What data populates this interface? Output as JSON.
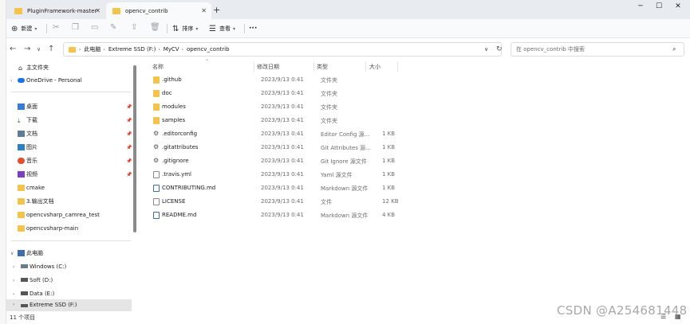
{
  "tabs": [
    {
      "label": "PluginFramework-master",
      "active": false
    },
    {
      "label": "opencv_contrib",
      "active": true
    }
  ],
  "window_controls": {
    "minimize": "─",
    "maximize": "☐",
    "close": "✕"
  },
  "command_bar": {
    "new_label": "新建",
    "sort_label": "排序",
    "view_label": "查看",
    "more_label": "···"
  },
  "breadcrumb": [
    "此电脑",
    "Extreme SSD (F:)",
    "MyCV",
    "opencv_contrib"
  ],
  "search": {
    "placeholder": "在 opencv_contrib 中搜索"
  },
  "nav": {
    "quick": [
      {
        "label": "主文件夹",
        "icon": "home-icon"
      },
      {
        "label": "OneDrive - Personal",
        "icon": "cloud-icon"
      }
    ],
    "pinned": [
      {
        "label": "桌面",
        "icon": "desktop-icon"
      },
      {
        "label": "下载",
        "icon": "download-icon"
      },
      {
        "label": "文档",
        "icon": "document-icon"
      },
      {
        "label": "图片",
        "icon": "picture-icon"
      },
      {
        "label": "音乐",
        "icon": "music-icon"
      },
      {
        "label": "视频",
        "icon": "video-icon"
      },
      {
        "label": "cmake",
        "icon": "folder-icon"
      },
      {
        "label": "3.输出文档",
        "icon": "folder-icon"
      },
      {
        "label": "opencvsharp_camrea_test",
        "icon": "folder-icon"
      },
      {
        "label": "opencvsharp-main",
        "icon": "folder-icon"
      }
    ],
    "this_pc": {
      "label": "此电脑",
      "icon": "computer-icon"
    },
    "drives": [
      {
        "label": "Windows (C:)"
      },
      {
        "label": "Soft (D:)"
      },
      {
        "label": "Data (E:)"
      },
      {
        "label": "Extreme SSD (F:)"
      }
    ]
  },
  "columns": {
    "name": "名称",
    "modified": "修改日期",
    "type": "类型",
    "size": "大小"
  },
  "files": [
    {
      "name": ".github",
      "modified": "2023/9/13 0:41",
      "type": "文件夹",
      "size": "",
      "kind": "folder"
    },
    {
      "name": "doc",
      "modified": "2023/9/13 0:41",
      "type": "文件夹",
      "size": "",
      "kind": "folder"
    },
    {
      "name": "modules",
      "modified": "2023/9/13 0:41",
      "type": "文件夹",
      "size": "",
      "kind": "folder"
    },
    {
      "name": "samples",
      "modified": "2023/9/13 0:41",
      "type": "文件夹",
      "size": "",
      "kind": "folder"
    },
    {
      "name": ".editorconfig",
      "modified": "2023/9/13 0:41",
      "type": "Editor Config 源...",
      "size": "1 KB",
      "kind": "gear"
    },
    {
      "name": ".gitattributes",
      "modified": "2023/9/13 0:41",
      "type": "Git Attributes 源...",
      "size": "1 KB",
      "kind": "gear"
    },
    {
      "name": ".gitignore",
      "modified": "2023/9/13 0:41",
      "type": "Git Ignore 源文件",
      "size": "1 KB",
      "kind": "gear"
    },
    {
      "name": ".travis.yml",
      "modified": "2023/9/13 0:41",
      "type": "Yaml 源文件",
      "size": "1 KB",
      "kind": "file"
    },
    {
      "name": "CONTRIBUTING.md",
      "modified": "2023/9/13 0:41",
      "type": "Markdown 源文件",
      "size": "1 KB",
      "kind": "md"
    },
    {
      "name": "LICENSE",
      "modified": "2023/9/13 0:41",
      "type": "文件",
      "size": "12 KB",
      "kind": "file"
    },
    {
      "name": "README.md",
      "modified": "2023/9/13 0:41",
      "type": "Markdown 源文件",
      "size": "4 KB",
      "kind": "md"
    }
  ],
  "status": {
    "item_count": "11 个项目"
  },
  "watermark": "CSDN @A254681448",
  "colors": {
    "folder": "#f3c34b",
    "accent": "#0067c0",
    "selected": "#e5e5e5"
  }
}
